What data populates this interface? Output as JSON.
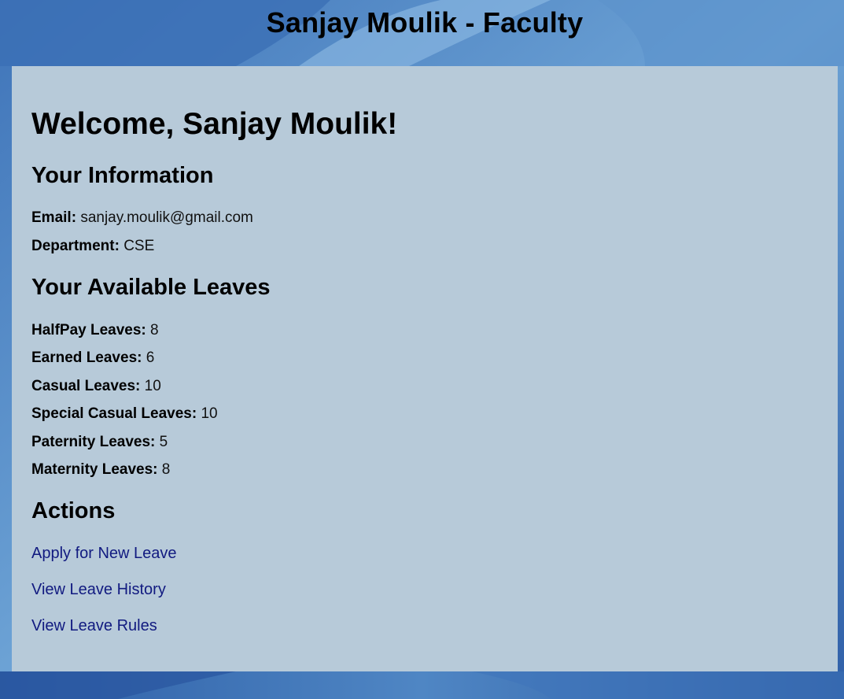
{
  "header": {
    "title": "Sanjay Moulik - Faculty"
  },
  "welcome": "Welcome, Sanjay Moulik!",
  "info": {
    "heading": "Your Information",
    "email_label": "Email:",
    "email_value": "sanjay.moulik@gmail.com",
    "department_label": "Department:",
    "department_value": "CSE"
  },
  "leaves": {
    "heading": "Your Available Leaves",
    "items": [
      {
        "label": "HalfPay Leaves:",
        "value": "8"
      },
      {
        "label": "Earned Leaves:",
        "value": "6"
      },
      {
        "label": "Casual Leaves:",
        "value": "10"
      },
      {
        "label": "Special Casual Leaves:",
        "value": "10"
      },
      {
        "label": "Paternity Leaves:",
        "value": "5"
      },
      {
        "label": "Maternity Leaves:",
        "value": "8"
      }
    ]
  },
  "actions": {
    "heading": "Actions",
    "links": [
      {
        "label": "Apply for New Leave"
      },
      {
        "label": "View Leave History"
      },
      {
        "label": "View Leave Rules"
      }
    ]
  },
  "colors": {
    "panel_bg": "#b7cad9",
    "link": "#111a80",
    "background": "#4f86c6"
  }
}
